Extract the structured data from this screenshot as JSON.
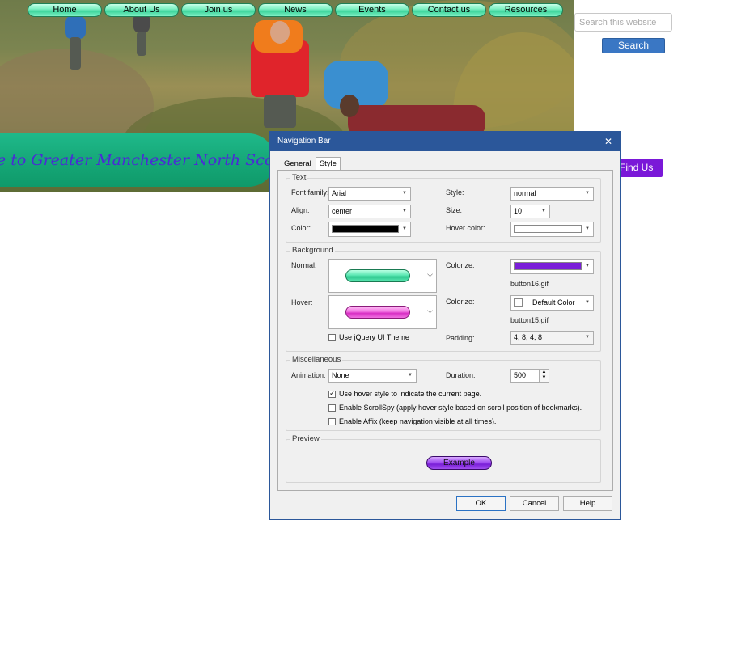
{
  "site": {
    "nav": [
      "Home",
      "About Us",
      "Join us",
      "News",
      "Events",
      "Contact us",
      "Resources"
    ],
    "banner_text": "e to Greater Manchester North Scouts",
    "search_placeholder": "Search this website",
    "search_button": "Search",
    "find_us_button": "Find Us",
    "colors": {
      "nav_button": "#7ff0c4",
      "banner": "#16a878",
      "banner_text": "#4a2bd6",
      "search_button": "#3a77c4",
      "find_us": "#7a18d8"
    }
  },
  "dialog": {
    "title": "Navigation Bar",
    "close_icon": "close-icon",
    "tabs": [
      "General",
      "Style"
    ],
    "active_tab": "Style",
    "text_group": {
      "legend": "Text",
      "font_family_label": "Font family:",
      "font_family_value": "Arial",
      "style_label": "Style:",
      "style_value": "normal",
      "align_label": "Align:",
      "align_value": "center",
      "size_label": "Size:",
      "size_value": "10",
      "color_label": "Color:",
      "color_value": "#000000",
      "hover_color_label": "Hover color:",
      "hover_color_value": "#ffffff"
    },
    "background_group": {
      "legend": "Background",
      "normal_label": "Normal:",
      "hover_label": "Hover:",
      "colorize_label_1": "Colorize:",
      "colorize_value_1": "#7a1fd8",
      "image_1": "button16.gif",
      "colorize_label_2": "Colorize:",
      "colorize_value_2": "Default Color",
      "image_2": "button15.gif",
      "jquery_label": "Use jQuery UI Theme",
      "jquery_checked": false,
      "padding_label": "Padding:",
      "padding_value": "4, 8, 4, 8",
      "normal_pill_color": "#3ddc9f",
      "hover_pill_color": "#e040d0"
    },
    "misc_group": {
      "legend": "Miscellaneous",
      "animation_label": "Animation:",
      "animation_value": "None",
      "duration_label": "Duration:",
      "duration_value": "500",
      "options": [
        {
          "label": "Use hover style to indicate the current page.",
          "checked": true
        },
        {
          "label": "Enable ScrollSpy (apply hover style based on scroll position of bookmarks).",
          "checked": false
        },
        {
          "label": "Enable Affix (keep navigation visible at all times).",
          "checked": false
        }
      ]
    },
    "preview_group": {
      "legend": "Preview",
      "example_label": "Example"
    },
    "buttons": {
      "ok": "OK",
      "cancel": "Cancel",
      "help": "Help"
    }
  }
}
